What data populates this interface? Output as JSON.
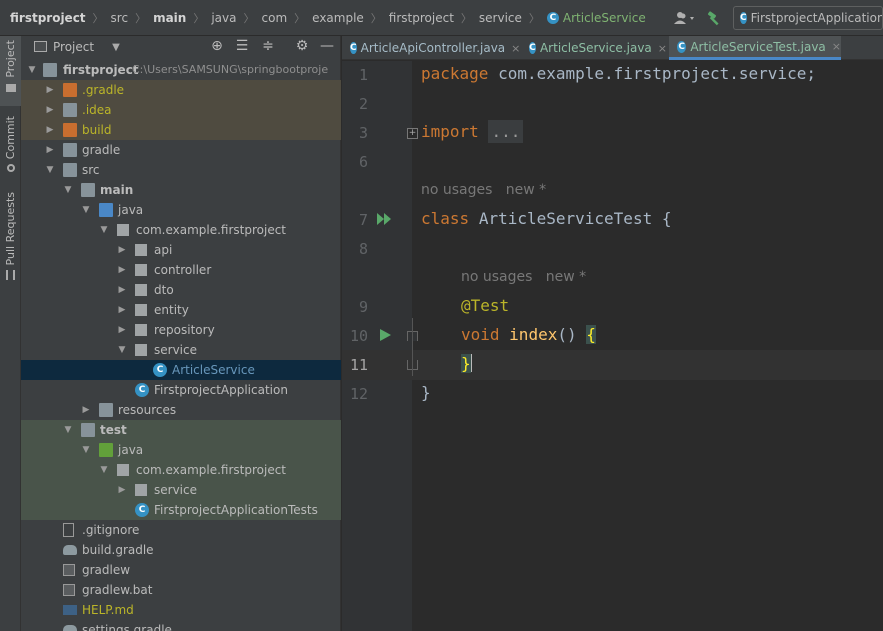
{
  "navbar": {
    "crumbs": [
      "firstproject",
      "src",
      "main",
      "java",
      "com",
      "example",
      "firstproject",
      "service",
      "ArticleService"
    ],
    "run_config": "FirstprojectApplication",
    "class_icon_letter": "C"
  },
  "toolstrip": {
    "project": "Project",
    "commit": "Commit",
    "pull_requests": "Pull Requests"
  },
  "project_panel": {
    "title": "Project",
    "tree": [
      {
        "label": "firstproject",
        "path": "C:\\Users\\SAMSUNG\\springbootproje"
      },
      {
        "label": ".gradle"
      },
      {
        "label": ".idea"
      },
      {
        "label": "build"
      },
      {
        "label": "gradle"
      },
      {
        "label": "src"
      },
      {
        "label": "main"
      },
      {
        "label": "java"
      },
      {
        "label": "com.example.firstproject"
      },
      {
        "label": "api"
      },
      {
        "label": "controller"
      },
      {
        "label": "dto"
      },
      {
        "label": "entity"
      },
      {
        "label": "repository"
      },
      {
        "label": "service"
      },
      {
        "label": "ArticleService"
      },
      {
        "label": "FirstprojectApplication"
      },
      {
        "label": "resources"
      },
      {
        "label": "test"
      },
      {
        "label": "java"
      },
      {
        "label": "com.example.firstproject"
      },
      {
        "label": "service"
      },
      {
        "label": "FirstprojectApplicationTests"
      },
      {
        "label": ".gitignore"
      },
      {
        "label": "build.gradle"
      },
      {
        "label": "gradlew"
      },
      {
        "label": "gradlew.bat"
      },
      {
        "label": "HELP.md"
      },
      {
        "label": "settings.gradle"
      }
    ]
  },
  "tabs": [
    {
      "label": "ArticleApiController.java",
      "close": "×"
    },
    {
      "label": "ArticleService.java",
      "close": "×"
    },
    {
      "label": "ArticleServiceTest.java",
      "close": "×"
    }
  ],
  "editor": {
    "line_numbers": [
      "1",
      "2",
      "3",
      "6",
      "7",
      "8",
      "9",
      "10",
      "11",
      "12"
    ],
    "package_kw": "package",
    "package_name": "com.example.firstproject.service;",
    "import_kw": "import",
    "import_fold": "...",
    "usage_hint_1": "no usages   new *",
    "class_kw": "class",
    "class_decl": "ArticleServiceTest {",
    "usage_hint_2": "no usages   new *",
    "annotation": "@Test",
    "void_kw": "void",
    "method_name": "index",
    "method_parens": "()",
    "open_brace": "{",
    "close_brace_inner": "}",
    "close_brace_outer": "}"
  },
  "colors": {
    "keyword": "#cc7832",
    "annotation": "#bbb529",
    "method": "#ffc66d",
    "text": "#a9b7c6",
    "accent": "#4a88c7"
  }
}
